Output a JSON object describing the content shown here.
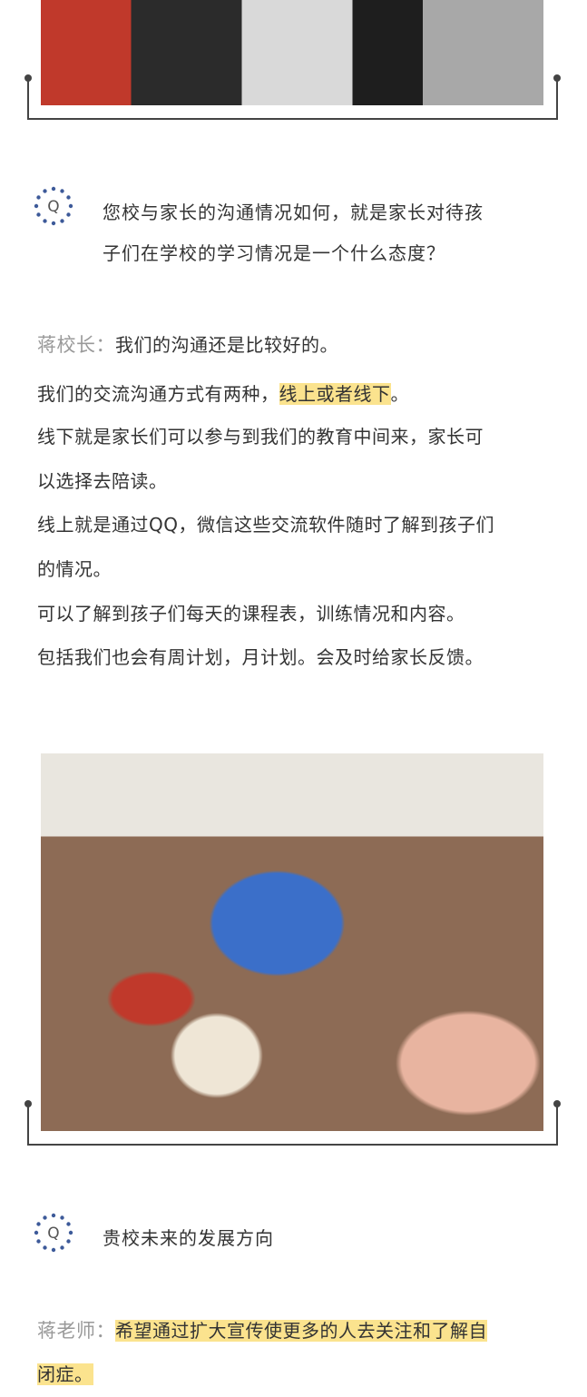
{
  "q1": {
    "icon_letter": "Q",
    "text_line1": "您校与家长的沟通情况如何，就是家长对待孩",
    "text_line2": "子们在学校的学习情况是一个什么态度？"
  },
  "answer1": {
    "speaker": "蒋校长：",
    "intro": "我们的沟通还是比较好的。",
    "p1_before": "我们的交流沟通方式有两种，",
    "p1_highlight": "线上或者线下",
    "p1_after": "。",
    "p2_line1": "线下就是家长们可以参与到我们的教育中间来，家长可",
    "p2_line2": "以选择去陪读。",
    "p3_line1": "线上就是通过QQ，微信这些交流软件随时了解到孩子们",
    "p3_line2": "的情况。",
    "p4": "可以了解到孩子们每天的课程表，训练情况和内容。",
    "p5": "包括我们也会有周计划，月计划。会及时给家长反馈。"
  },
  "q2": {
    "icon_letter": "Q",
    "text": "贵校未来的发展方向"
  },
  "answer2": {
    "speaker": "蒋老师：",
    "highlight_line1": "希望通过扩大宣传使更多的人去关注和了解自",
    "highlight_line2": "闭症。"
  },
  "colors": {
    "highlight": "#fbe38e",
    "speaker": "#999999",
    "icon_dots": "#3d5a99",
    "frame": "#444444"
  }
}
